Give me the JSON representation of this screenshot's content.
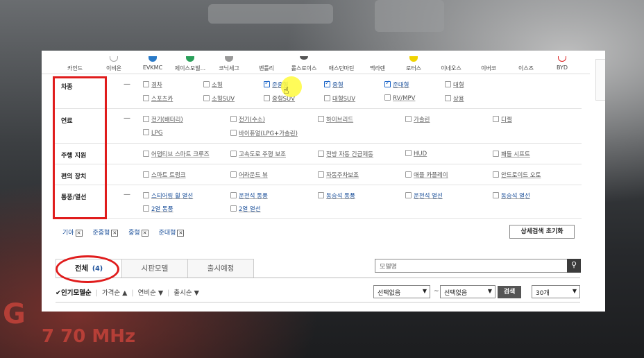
{
  "brands": [
    "카인드",
    "이비온",
    "EVKMC",
    "제이스모빌...",
    "코닉세그",
    "벤틀리",
    "롤스로이스",
    "애스턴마틴",
    "맥라렌",
    "로터스",
    "이네오스",
    "이버코",
    "이스즈",
    "BYD"
  ],
  "filters": {
    "vehicle_type": {
      "label": "차종",
      "dash": "—",
      "options": [
        {
          "text": "경차",
          "checked": false
        },
        {
          "text": "소형",
          "checked": false
        },
        {
          "text": "준중형",
          "checked": true
        },
        {
          "text": "중형",
          "checked": true
        },
        {
          "text": "준대형",
          "checked": true
        },
        {
          "text": "대형",
          "checked": false
        },
        {
          "text": "스포츠카",
          "checked": false
        },
        {
          "text": "소형SUV",
          "checked": false
        },
        {
          "text": "중형SUV",
          "checked": false
        },
        {
          "text": "대형SUV",
          "checked": false
        },
        {
          "text": "RV/MPV",
          "checked": false
        },
        {
          "text": "상용",
          "checked": false
        }
      ]
    },
    "fuel": {
      "label": "연료",
      "dash": "—",
      "options": [
        "전기(배터리)",
        "전기(수소)",
        "하이브리드",
        "가솔린",
        "디젤",
        "LPG",
        "바이퓨얼(LPG+가솔린)"
      ]
    },
    "driving_assist": {
      "label": "주행 지원",
      "options": [
        "어댑티브 스마트 크루즈",
        "고속도로 주행 보조",
        "전방 자동 긴급제동",
        "HUD",
        "패들 시프트"
      ]
    },
    "convenience": {
      "label": "편의 장치",
      "options": [
        "스마트 트렁크",
        "어라운드 뷰",
        "자동주차보조",
        "애플 카플레이",
        "안드로이드 오토"
      ]
    },
    "ventilation": {
      "label": "통풍/열선",
      "dash": "—",
      "options": [
        "스티어링 휠 열선",
        "운전석 통풍",
        "동승석 통풍",
        "운전석 열선",
        "동승석 열선",
        "2열 통풍",
        "2열 열선"
      ]
    }
  },
  "selected_chips": [
    "기아",
    "준중형",
    "중형",
    "준대형"
  ],
  "chip_close_glyph": "✕",
  "reset_button": "상세검색 초기화",
  "tabs": [
    {
      "label": "전체",
      "count": "(4)"
    },
    {
      "label": "시판모델"
    },
    {
      "label": "출시예정"
    }
  ],
  "search": {
    "placeholder": "모델명",
    "icon": "search-icon"
  },
  "sort": {
    "active": "인기모델순",
    "options": [
      "가격순 ▲",
      "연비순 ▼",
      "출시순 ▼"
    ]
  },
  "select_from": "선택없음",
  "select_to": "선택없음",
  "tilde": "~",
  "search_go": "검색",
  "page_size": "30개",
  "colors": {
    "annotation_red": "#e01c1c",
    "link_blue": "#1a4f9a",
    "check_blue": "#1a64c8",
    "highlight_yellow": "#fffa3c"
  }
}
